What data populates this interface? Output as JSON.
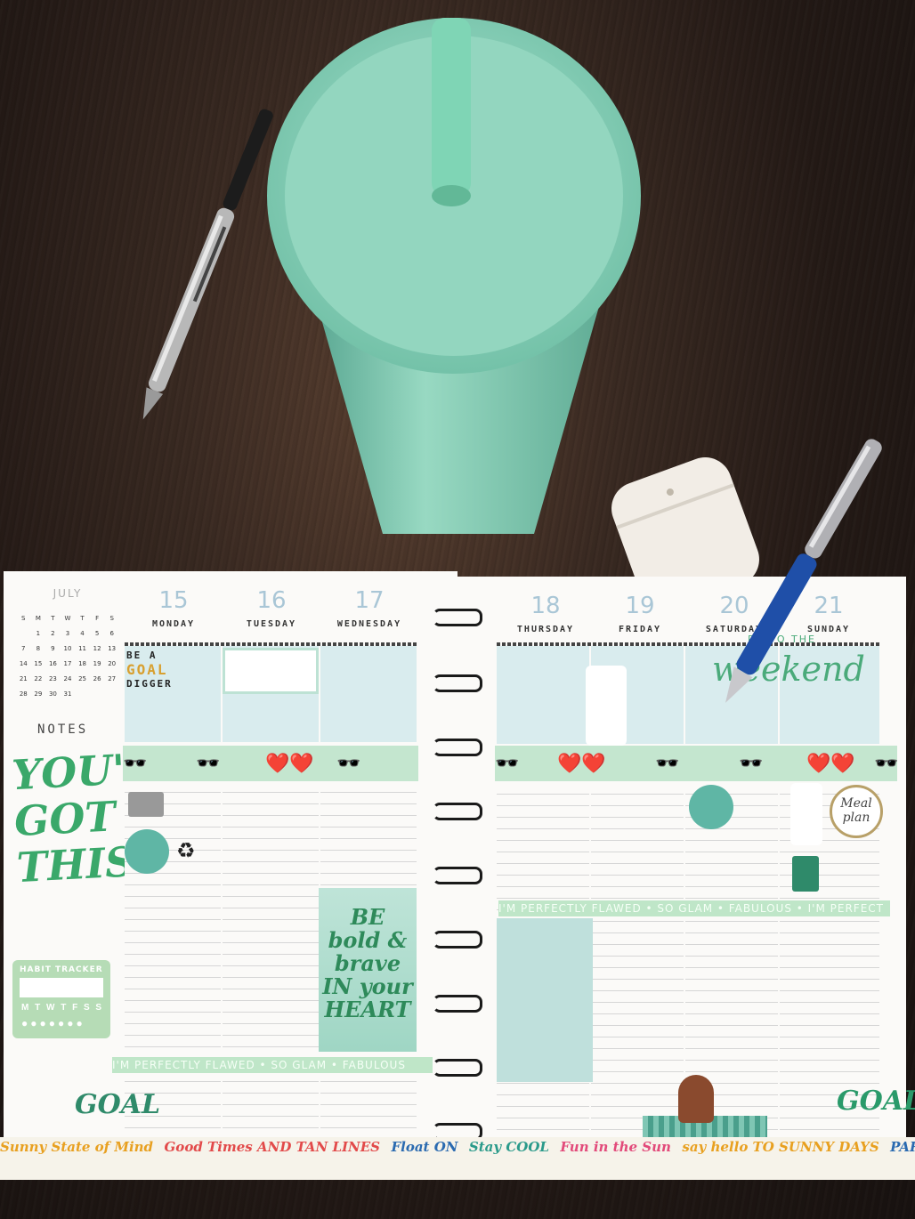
{
  "planner": {
    "mini_calendar": {
      "month": "JULY",
      "weekday_headers": [
        "S",
        "M",
        "T",
        "W",
        "T",
        "F",
        "S"
      ],
      "dates": [
        [
          "",
          "1",
          "2",
          "3",
          "4",
          "5",
          "6"
        ],
        [
          "7",
          "8",
          "9",
          "10",
          "11",
          "12",
          "13"
        ],
        [
          "14",
          "15",
          "16",
          "17",
          "18",
          "19",
          "20"
        ],
        [
          "21",
          "22",
          "23",
          "24",
          "25",
          "26",
          "27"
        ],
        [
          "28",
          "29",
          "30",
          "31",
          "",
          "",
          ""
        ]
      ]
    },
    "days": [
      {
        "num": "15",
        "name": "MONDAY"
      },
      {
        "num": "16",
        "name": "TUESDAY"
      },
      {
        "num": "17",
        "name": "WEDNESDAY"
      },
      {
        "num": "18",
        "name": "THURSDAY"
      },
      {
        "num": "19",
        "name": "FRIDAY"
      },
      {
        "num": "20",
        "name": "SATURDAY"
      },
      {
        "num": "21",
        "name": "SUNDAY"
      }
    ],
    "notes_title": "NOTES",
    "notes_sticker": [
      "YOU'VE",
      "GOT",
      "THIS"
    ],
    "goal_digger": [
      "BE A",
      "GOAL",
      "DIGGER"
    ],
    "brave_card": [
      "BE",
      "bold &",
      "brave",
      "IN your",
      "HEART"
    ],
    "habit_tracker_label": "HABIT TRACKER",
    "habit_days": "M T W T F S S",
    "perfect_strip_left": "I'M PERFECTLY FLAWED • SO GLAM • FABULOUS",
    "perfect_strip_right": "I'M PERFECTLY FLAWED • SO GLAM • FABULOUS • I'M PERFECT",
    "weekend_small": "RS TO THE",
    "weekend_big": "weekend",
    "meal_plan": [
      "Meal",
      "plan"
    ],
    "goal_text": "GOAL",
    "bottom_washi": [
      "Sunny State of Mind",
      "Good Times AND TAN LINES",
      "Float ON",
      "Stay COOL",
      "Fun in the Sun",
      "say hello TO SUNNY DAYS",
      "PARADISE POOLSIDE"
    ]
  },
  "colors": {
    "table": "#2a1e19",
    "tumbler": "#8fd4bd",
    "mint": "#c4e6cf",
    "day_number": "#a9c6d6"
  }
}
